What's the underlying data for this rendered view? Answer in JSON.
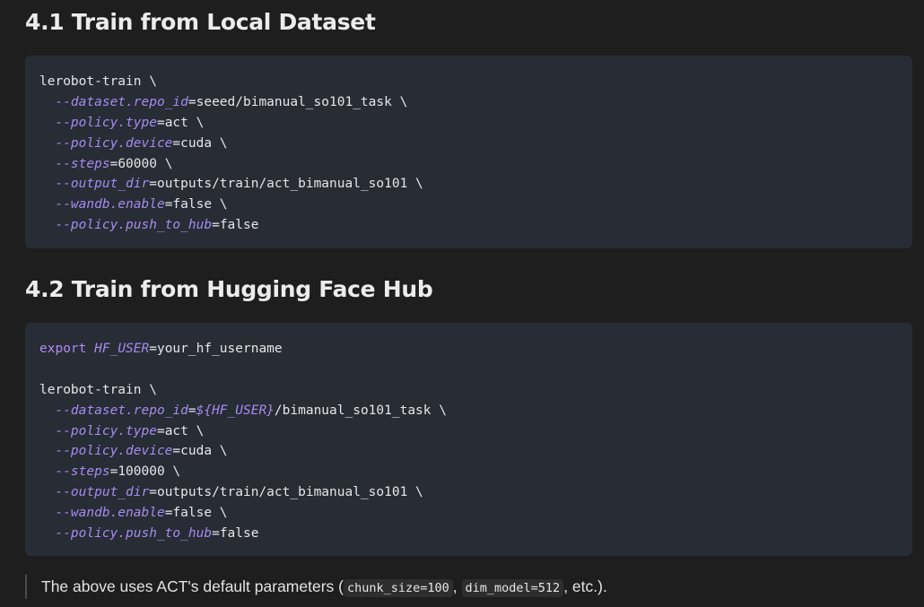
{
  "section1": {
    "heading": "4.1 Train from Local Dataset",
    "code": {
      "cmd": "lerobot-train \\",
      "args": [
        {
          "flag": "--dataset.repo_id",
          "eq": "=",
          "value": "seeed/bimanual_so101_task \\"
        },
        {
          "flag": "--policy.type",
          "eq": "=",
          "value": "act \\"
        },
        {
          "flag": "--policy.device",
          "eq": "=",
          "value": "cuda \\"
        },
        {
          "flag": "--steps",
          "eq": "=",
          "value": "60000 \\"
        },
        {
          "flag": "--output_dir",
          "eq": "=",
          "value": "outputs/train/act_bimanual_so101 \\"
        },
        {
          "flag": "--wandb.enable",
          "eq": "=",
          "value": "false \\"
        },
        {
          "flag": "--policy.push_to_hub",
          "eq": "=",
          "value": "false"
        }
      ]
    }
  },
  "section2": {
    "heading": "4.2 Train from Hugging Face Hub",
    "code": {
      "export_kw": "export",
      "export_var": "HF_USER",
      "export_eq": "=",
      "export_value": "your_hf_username",
      "cmd": "lerobot-train \\",
      "repo_flag": "--dataset.repo_id",
      "repo_eq": "=",
      "repo_var": "${HF_USER}",
      "repo_value": "/bimanual_so101_task \\",
      "args": [
        {
          "flag": "--policy.type",
          "eq": "=",
          "value": "act \\"
        },
        {
          "flag": "--policy.device",
          "eq": "=",
          "value": "cuda \\"
        },
        {
          "flag": "--steps",
          "eq": "=",
          "value": "100000 \\"
        },
        {
          "flag": "--output_dir",
          "eq": "=",
          "value": "outputs/train/act_bimanual_so101 \\"
        },
        {
          "flag": "--wandb.enable",
          "eq": "=",
          "value": "false \\"
        },
        {
          "flag": "--policy.push_to_hub",
          "eq": "=",
          "value": "false"
        }
      ]
    }
  },
  "note": {
    "prefix": "The above uses ACT's default parameters (",
    "code1": "chunk_size=100",
    "sep": ", ",
    "code2": "dim_model=512",
    "suffix": ", etc.)."
  }
}
